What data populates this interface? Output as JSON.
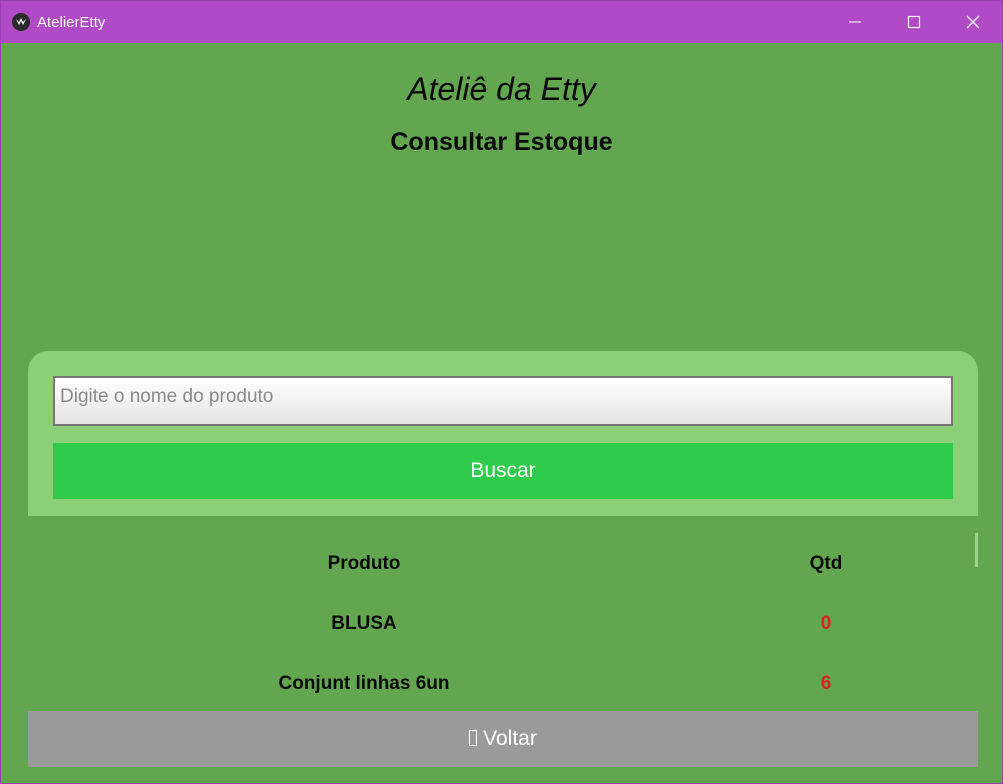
{
  "window": {
    "title": "AtelierEtty",
    "app_icon": "kivy-logo-icon",
    "controls": [
      "minimize-icon",
      "maximize-icon",
      "close-icon"
    ]
  },
  "header": {
    "title": "Ateliê da Etty",
    "subtitle": "Consultar Estoque"
  },
  "search": {
    "placeholder": "Digite o nome do produto",
    "value": "",
    "button_label": "Buscar"
  },
  "table": {
    "columns": [
      "Produto",
      "Qtd"
    ],
    "rows": [
      {
        "produto": "BLUSA",
        "qtd": "0"
      },
      {
        "produto": "Conjunt linhas 6un",
        "qtd": "6"
      }
    ]
  },
  "footer": {
    "back_label": "Voltar",
    "back_icon": "missing-glyph-icon"
  },
  "colors": {
    "titlebar": "#b04ac6",
    "background": "#62a64f",
    "card": "#8bd077",
    "button": "#2ecc4a",
    "back_button": "#9a9a9a",
    "qtd_value": "#d42424"
  }
}
